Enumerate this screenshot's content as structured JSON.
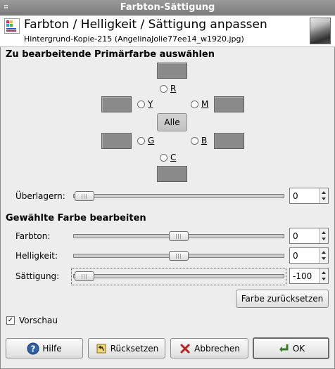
{
  "window": {
    "title": "Farbton-Sättigung"
  },
  "header": {
    "title": "Farbton / Helligkeit / Sättigung anpassen",
    "subtitle": "Hintergrund-Kopie-215 (AngelinaJolie77ee14_w1920.jpg)"
  },
  "primary_section": {
    "title": "Zu bearbeitende Primärfarbe auswählen",
    "channels": [
      {
        "label": "R"
      },
      {
        "label": "Y"
      },
      {
        "label": "M"
      },
      {
        "label": "G"
      },
      {
        "label": "B"
      },
      {
        "label": "C"
      }
    ],
    "all_button": {
      "label": "Alle"
    },
    "swatch_color": "#8a8a8a"
  },
  "overlap": {
    "label": "Überlagern:",
    "value": "0",
    "fraction": 0.0
  },
  "edit_section": {
    "title": "Gewählte Farbe bearbeiten",
    "hue": {
      "label": "Farbton:",
      "value": "0",
      "fraction": 0.5
    },
    "lightness": {
      "label": "Helligkeit:",
      "value": "0",
      "fraction": 0.5
    },
    "saturation": {
      "label": "Sättigung:",
      "value": "-100",
      "fraction": 0.0
    },
    "reset_color_button": "Farbe zurücksetzen"
  },
  "preview": {
    "label": "Vorschau",
    "checked": true
  },
  "buttons": {
    "help": "Hilfe",
    "reset": "Rücksetzen",
    "cancel": "Abbrechen",
    "ok": "OK"
  }
}
